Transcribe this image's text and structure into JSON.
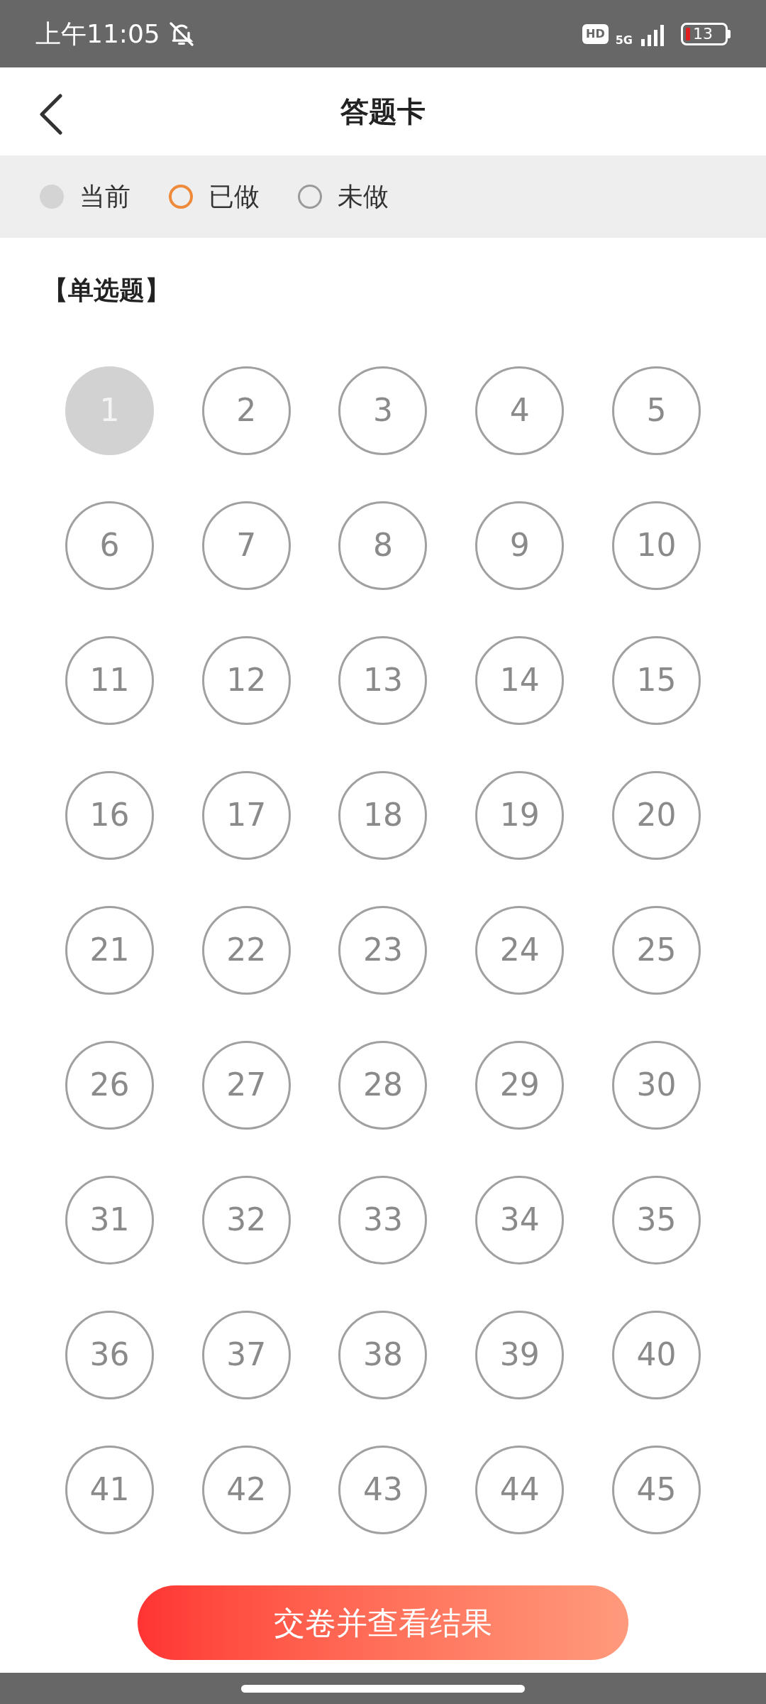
{
  "status_bar": {
    "time": "上午11:05",
    "hd": "HD",
    "network": "5G",
    "battery": "13"
  },
  "header": {
    "title": "答题卡"
  },
  "legend": [
    {
      "kind": "current",
      "label": "当前"
    },
    {
      "kind": "done",
      "label": "已做"
    },
    {
      "kind": "todo",
      "label": "未做"
    }
  ],
  "section": {
    "title": "【单选题】"
  },
  "questions": [
    {
      "number": "1",
      "kind": "current"
    },
    {
      "number": "2",
      "kind": "todo"
    },
    {
      "number": "3",
      "kind": "todo"
    },
    {
      "number": "4",
      "kind": "todo"
    },
    {
      "number": "5",
      "kind": "todo"
    },
    {
      "number": "6",
      "kind": "todo"
    },
    {
      "number": "7",
      "kind": "todo"
    },
    {
      "number": "8",
      "kind": "todo"
    },
    {
      "number": "9",
      "kind": "todo"
    },
    {
      "number": "10",
      "kind": "todo"
    },
    {
      "number": "11",
      "kind": "todo"
    },
    {
      "number": "12",
      "kind": "todo"
    },
    {
      "number": "13",
      "kind": "todo"
    },
    {
      "number": "14",
      "kind": "todo"
    },
    {
      "number": "15",
      "kind": "todo"
    },
    {
      "number": "16",
      "kind": "todo"
    },
    {
      "number": "17",
      "kind": "todo"
    },
    {
      "number": "18",
      "kind": "todo"
    },
    {
      "number": "19",
      "kind": "todo"
    },
    {
      "number": "20",
      "kind": "todo"
    },
    {
      "number": "21",
      "kind": "todo"
    },
    {
      "number": "22",
      "kind": "todo"
    },
    {
      "number": "23",
      "kind": "todo"
    },
    {
      "number": "24",
      "kind": "todo"
    },
    {
      "number": "25",
      "kind": "todo"
    },
    {
      "number": "26",
      "kind": "todo"
    },
    {
      "number": "27",
      "kind": "todo"
    },
    {
      "number": "28",
      "kind": "todo"
    },
    {
      "number": "29",
      "kind": "todo"
    },
    {
      "number": "30",
      "kind": "todo"
    },
    {
      "number": "31",
      "kind": "todo"
    },
    {
      "number": "32",
      "kind": "todo"
    },
    {
      "number": "33",
      "kind": "todo"
    },
    {
      "number": "34",
      "kind": "todo"
    },
    {
      "number": "35",
      "kind": "todo"
    },
    {
      "number": "36",
      "kind": "todo"
    },
    {
      "number": "37",
      "kind": "todo"
    },
    {
      "number": "38",
      "kind": "todo"
    },
    {
      "number": "39",
      "kind": "todo"
    },
    {
      "number": "40",
      "kind": "todo"
    },
    {
      "number": "41",
      "kind": "todo"
    },
    {
      "number": "42",
      "kind": "todo"
    },
    {
      "number": "43",
      "kind": "todo"
    },
    {
      "number": "44",
      "kind": "todo"
    },
    {
      "number": "45",
      "kind": "todo"
    }
  ],
  "submit_button": {
    "label": "交卷并查看结果"
  }
}
